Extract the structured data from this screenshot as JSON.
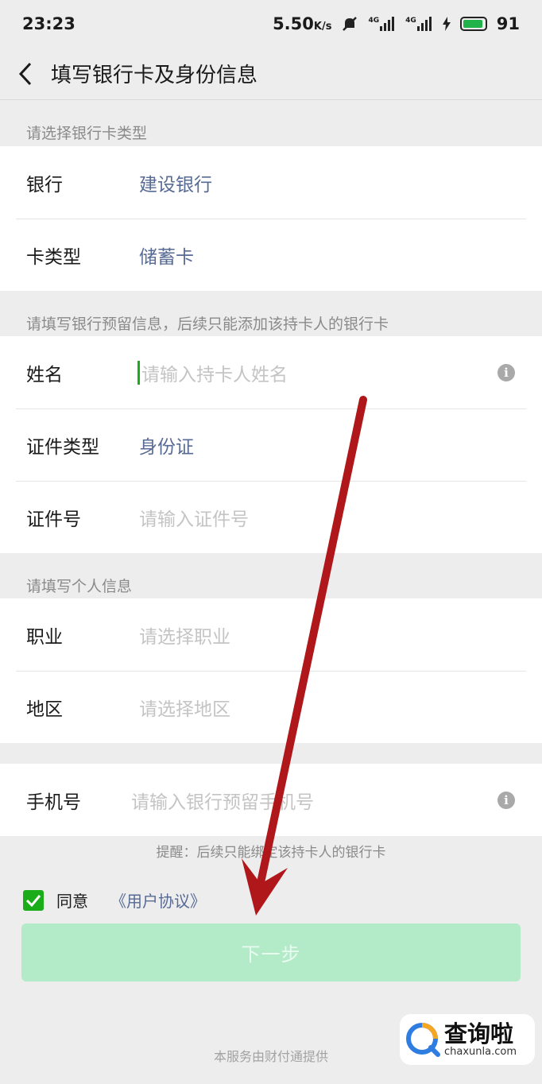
{
  "status": {
    "time": "23:23",
    "speed": "5.50",
    "speed_unit": "K/s",
    "net1": "4G",
    "net2": "4G",
    "battery_level": 91,
    "battery": "91"
  },
  "nav": {
    "title": "填写银行卡及身份信息"
  },
  "section1": {
    "header": "请选择银行卡类型",
    "bank_label": "银行",
    "bank_value": "建设银行",
    "card_type_label": "卡类型",
    "card_type_value": "储蓄卡"
  },
  "section2": {
    "header": "请填写银行预留信息，后续只能添加该持卡人的银行卡",
    "name_label": "姓名",
    "name_placeholder": "请输入持卡人姓名",
    "id_type_label": "证件类型",
    "id_type_value": "身份证",
    "id_number_label": "证件号",
    "id_number_placeholder": "请输入证件号"
  },
  "section3": {
    "header": "请填写个人信息",
    "occupation_label": "职业",
    "occupation_placeholder": "请选择职业",
    "region_label": "地区",
    "region_placeholder": "请选择地区"
  },
  "phone": {
    "label": "手机号",
    "placeholder": "请输入银行预留手机号"
  },
  "hint": "提醒：后续只能绑定该持卡人的银行卡",
  "agreement": {
    "checked": true,
    "label": "同意",
    "link": "《用户协议》"
  },
  "next_button": "下一步",
  "footer": "本服务由财付通提供",
  "watermark": {
    "title": "查询啦",
    "url": "chaxunla.com"
  },
  "colors": {
    "accent": "#1aad19",
    "link": "#576b95",
    "button_disabled": "#b3ebc9",
    "arrow": "#b0171a"
  }
}
